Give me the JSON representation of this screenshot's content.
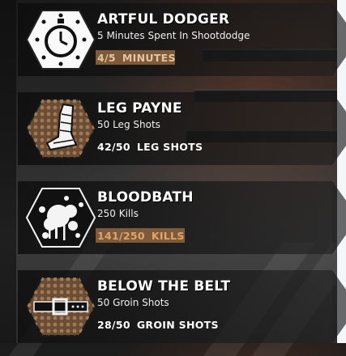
{
  "achievements": [
    {
      "title": "ARTFUL DODGER",
      "description": "5 Minutes Spent In Shootdodge",
      "progress": "4/5",
      "unit": "MINUTES",
      "fraction": 0.8,
      "icon": "stopwatch-icon"
    },
    {
      "title": "LEG PAYNE",
      "description": "50 Leg Shots",
      "progress": "42/50",
      "unit": "LEG SHOTS",
      "fraction": 0.84,
      "icon": "bandaged-leg-icon"
    },
    {
      "title": "BLOODBATH",
      "description": "250 Kills",
      "progress": "141/250",
      "unit": "KILLS",
      "fraction": 0.564,
      "icon": "blood-splatter-icon"
    },
    {
      "title": "BELOW THE BELT",
      "description": "50 Groin Shots",
      "progress": "28/50",
      "unit": "GROIN SHOTS",
      "fraction": 0.56,
      "icon": "belt-icon"
    }
  ],
  "colors": {
    "accent_bar": "#7c5a3a",
    "progress_text": "#e2a46d",
    "hex_bg": "#7a5a42"
  }
}
